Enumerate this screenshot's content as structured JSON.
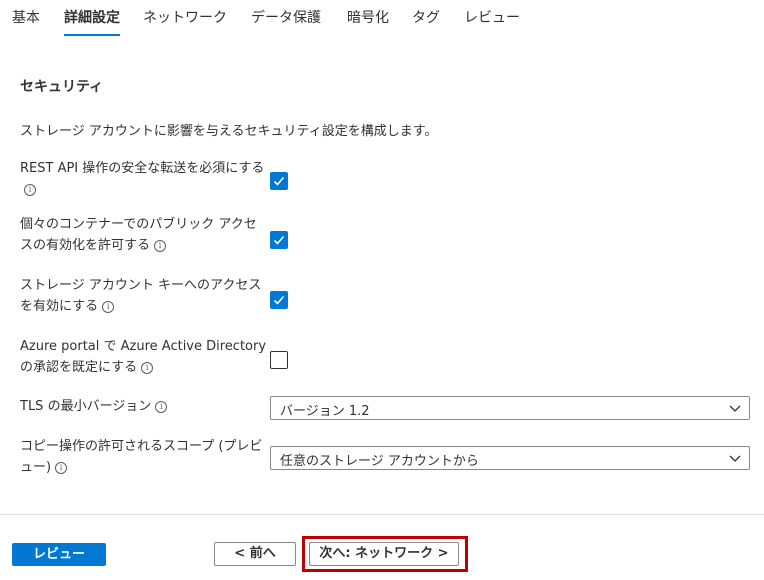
{
  "tabs": [
    {
      "label": "基本",
      "active": false
    },
    {
      "label": "詳細設定",
      "active": true
    },
    {
      "label": "ネットワーク",
      "active": false
    },
    {
      "label": "データ保護",
      "active": false
    },
    {
      "label": "暗号化",
      "active": false
    },
    {
      "label": "タグ",
      "active": false
    },
    {
      "label": "レビュー",
      "active": false
    }
  ],
  "section": {
    "title": "セキュリティ",
    "description": "ストレージ アカウントに影響を与えるセキュリティ設定を構成します。"
  },
  "settings": {
    "secure_transfer": {
      "label": "REST API 操作の安全な転送を必須にする",
      "checked": true
    },
    "public_access": {
      "label": "個々のコンテナーでのパブリック アクセスの有効化を許可する",
      "checked": true
    },
    "key_access": {
      "label": "ストレージ アカウント キーへのアクセスを有効にする",
      "checked": true
    },
    "aad_authorization": {
      "label": "Azure portal で Azure Active Directory の承認を既定にする",
      "checked": false
    },
    "tls_version": {
      "label": "TLS の最小バージョン",
      "value": "バージョン 1.2"
    },
    "copy_scope": {
      "label": "コピー操作の許可されるスコープ (プレビュー)",
      "value": "任意のストレージ アカウントから"
    }
  },
  "icons": {
    "info": "info-icon",
    "check": "checkmark-icon",
    "chevron": "chevron-down-icon"
  },
  "info_glyph": "i",
  "footer": {
    "review_button": "レビュー",
    "prev_button": "< 前へ",
    "next_button": "次へ: ネットワーク >"
  },
  "colors": {
    "accent": "#0078d4",
    "highlight": "#c00000",
    "text": "#323130"
  }
}
